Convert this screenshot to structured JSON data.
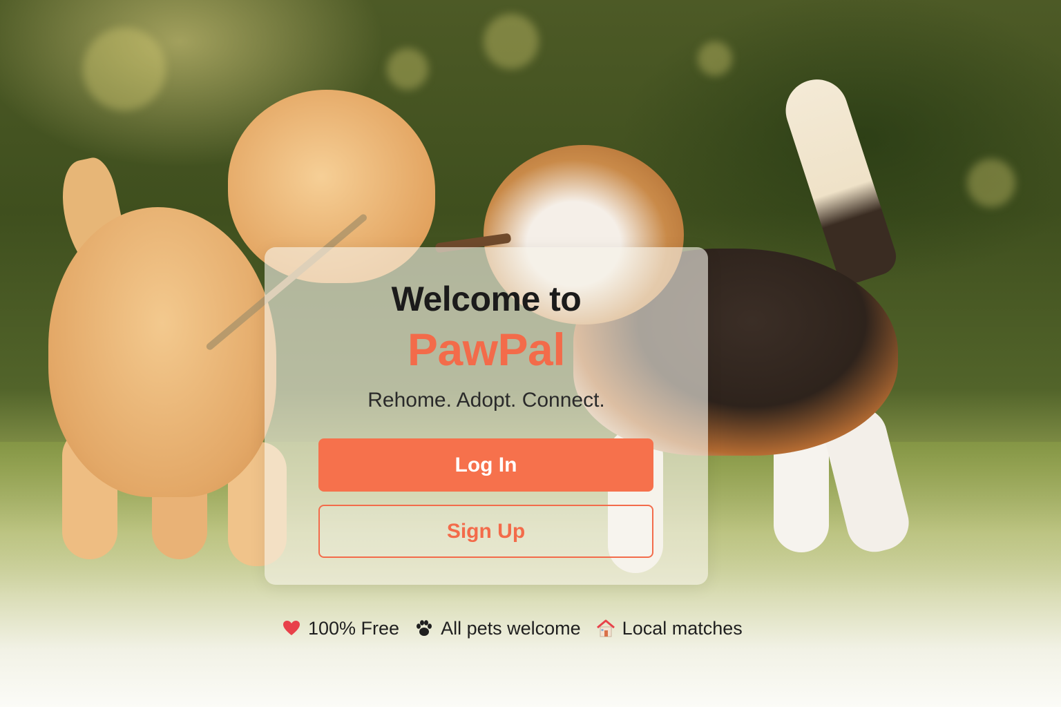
{
  "card": {
    "title": "Welcome to",
    "brand": "PawPal",
    "tagline": "Rehome. Adopt. Connect.",
    "login_label": "Log In",
    "signup_label": "Sign Up"
  },
  "features": [
    {
      "icon": "heart-icon",
      "label": "100% Free"
    },
    {
      "icon": "paw-icon",
      "label": "All pets welcome"
    },
    {
      "icon": "house-icon",
      "label": "Local matches"
    }
  ],
  "colors": {
    "accent": "#f6714c",
    "brand": "#f36b4a",
    "heart": "#e8414a"
  },
  "background": {
    "icon": "puppies-playing-photo"
  }
}
